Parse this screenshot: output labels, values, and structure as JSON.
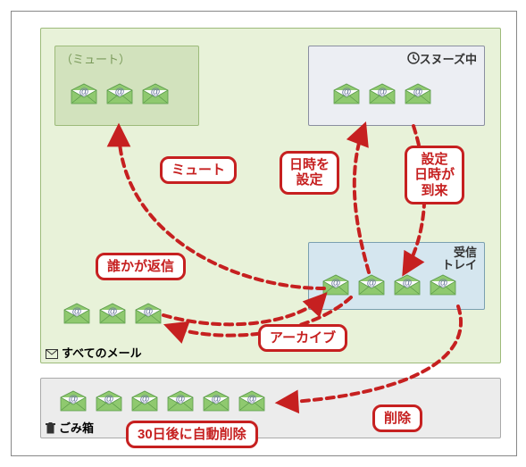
{
  "boxes": {
    "all_mail": {
      "label": "すべてのメール"
    },
    "mute": {
      "label": "（ミュート）"
    },
    "snooze": {
      "label": "スヌーズ中"
    },
    "inbox": {
      "label": "受信\nトレイ"
    },
    "trash": {
      "label": "ごみ箱"
    }
  },
  "callouts": {
    "mute_action": "ミュート",
    "set_datetime": "日時を\n設定",
    "datetime_arrive": "設定\n日時が\n到来",
    "someone_reply": "誰かが返信",
    "archive": "アーカイブ",
    "delete": "削除",
    "auto_delete": "30日後に自動削除"
  },
  "icons": {
    "mail": "mail-at-icon",
    "clock": "clock-icon",
    "envelope": "envelope-icon",
    "trash": "trash-icon"
  }
}
